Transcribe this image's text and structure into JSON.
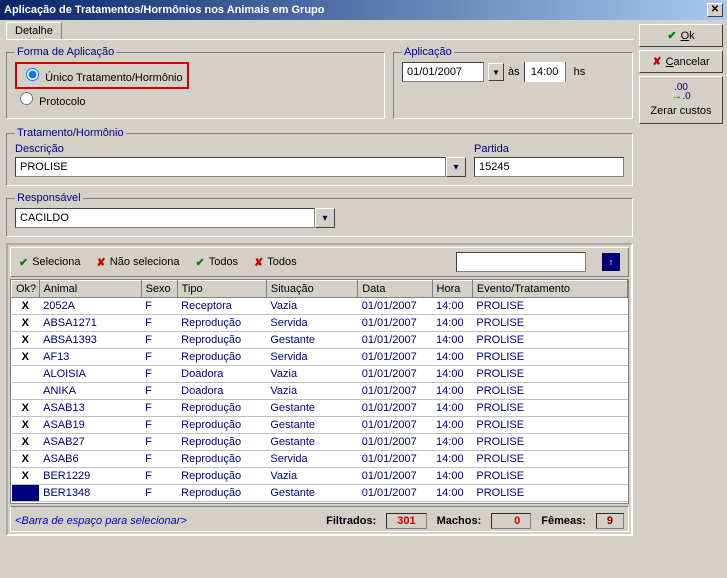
{
  "title": "Aplicação de Tratamentos/Hormônios nos Animais em Grupo",
  "tab": "Detalhe",
  "forma": {
    "legend": "Forma de Aplicação",
    "opt1": "Único Tratamento/Hormônio",
    "opt2": "Protocolo"
  },
  "aplicacao": {
    "legend": "Aplicação",
    "date": "01/01/2007",
    "as": "às",
    "time": "14:00",
    "hs": "hs"
  },
  "trat": {
    "legend": "Tratamento/Hormônio",
    "descricao_label": "Descrição",
    "descricao": "PROLISE",
    "partida_label": "Partida",
    "partida": "15245"
  },
  "responsavel": {
    "label": "Responsável",
    "value": "CACILDO"
  },
  "buttons": {
    "ok": "Ok",
    "cancelar": "Cancelar",
    "zerar": "Zerar custos"
  },
  "toolbar": {
    "seleciona": "Seleciona",
    "nao_seleciona": "Não seleciona",
    "todos1": "Todos",
    "todos2": "Todos"
  },
  "columns": {
    "ok": "Ok?",
    "animal": "Animal",
    "sexo": "Sexo",
    "tipo": "Tipo",
    "situacao": "Situação",
    "data": "Data",
    "hora": "Hora",
    "evento": "Evento/Tratamento"
  },
  "rows": [
    {
      "ok": "X",
      "animal": "2052A",
      "sexo": "F",
      "tipo": "Receptora",
      "sit": "Vazia",
      "data": "01/01/2007",
      "hora": "14:00",
      "evt": "PROLISE"
    },
    {
      "ok": "X",
      "animal": "ABSA1271",
      "sexo": "F",
      "tipo": "Reprodução",
      "sit": "Servida",
      "data": "01/01/2007",
      "hora": "14:00",
      "evt": "PROLISE"
    },
    {
      "ok": "X",
      "animal": "ABSA1393",
      "sexo": "F",
      "tipo": "Reprodução",
      "sit": "Gestante",
      "data": "01/01/2007",
      "hora": "14:00",
      "evt": "PROLISE"
    },
    {
      "ok": "X",
      "animal": "AF13",
      "sexo": "F",
      "tipo": "Reprodução",
      "sit": "Servida",
      "data": "01/01/2007",
      "hora": "14:00",
      "evt": "PROLISE"
    },
    {
      "ok": "",
      "animal": "ALOISIA",
      "sexo": "F",
      "tipo": "Doadora",
      "sit": "Vazia",
      "data": "01/01/2007",
      "hora": "14:00",
      "evt": "PROLISE"
    },
    {
      "ok": "",
      "animal": "ANIKA",
      "sexo": "F",
      "tipo": "Doadora",
      "sit": "Vazia",
      "data": "01/01/2007",
      "hora": "14:00",
      "evt": "PROLISE"
    },
    {
      "ok": "X",
      "animal": "ASAB13",
      "sexo": "F",
      "tipo": "Reprodução",
      "sit": "Gestante",
      "data": "01/01/2007",
      "hora": "14:00",
      "evt": "PROLISE"
    },
    {
      "ok": "X",
      "animal": "ASAB19",
      "sexo": "F",
      "tipo": "Reprodução",
      "sit": "Gestante",
      "data": "01/01/2007",
      "hora": "14:00",
      "evt": "PROLISE"
    },
    {
      "ok": "X",
      "animal": "ASAB27",
      "sexo": "F",
      "tipo": "Reprodução",
      "sit": "Gestante",
      "data": "01/01/2007",
      "hora": "14:00",
      "evt": "PROLISE"
    },
    {
      "ok": "X",
      "animal": "ASAB6",
      "sexo": "F",
      "tipo": "Reprodução",
      "sit": "Servida",
      "data": "01/01/2007",
      "hora": "14:00",
      "evt": "PROLISE"
    },
    {
      "ok": "X",
      "animal": "BER1229",
      "sexo": "F",
      "tipo": "Reprodução",
      "sit": "Vazia",
      "data": "01/01/2007",
      "hora": "14:00",
      "evt": "PROLISE"
    },
    {
      "ok": "",
      "animal": "BER1348",
      "sexo": "F",
      "tipo": "Reprodução",
      "sit": "Gestante",
      "data": "01/01/2007",
      "hora": "14:00",
      "evt": "PROLISE",
      "sel": true
    }
  ],
  "footer": {
    "hint": "<Barra de espaço para selecionar>",
    "filtrados_label": "Filtrados:",
    "filtrados": "301",
    "machos_label": "Machos:",
    "machos": "0",
    "femeas_label": "Fêmeas:",
    "femeas": "9"
  }
}
